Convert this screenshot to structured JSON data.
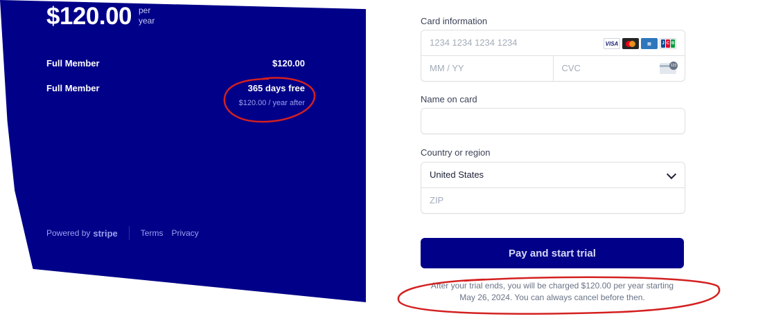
{
  "summary": {
    "price": "$120.00",
    "period_line1": "per",
    "period_line2": "year",
    "items": [
      {
        "label": "Full Member",
        "value": "$120.00",
        "sub": ""
      },
      {
        "label": "Full Member",
        "value": "365 days free",
        "sub": "$120.00 / year after"
      }
    ],
    "footer": {
      "powered_by": "Powered by",
      "stripe": "stripe",
      "terms": "Terms",
      "privacy": "Privacy"
    },
    "background_color": "#010088"
  },
  "form": {
    "card_label": "Card information",
    "card_number_placeholder": "1234 1234 1234 1234",
    "expiry_placeholder": "MM / YY",
    "cvc_placeholder": "CVC",
    "card_brands": [
      "VISA",
      "mastercard",
      "amex",
      "JCB"
    ],
    "name_label": "Name on card",
    "name_value": "",
    "country_label": "Country or region",
    "country_value": "United States",
    "zip_placeholder": "ZIP",
    "pay_button": "Pay and start trial",
    "disclaimer_line1": "After your trial ends, you will be charged $120.00 per year starting",
    "disclaimer_line2": "May 26, 2024. You can always cancel before then."
  },
  "annotation_color": "#d42020"
}
